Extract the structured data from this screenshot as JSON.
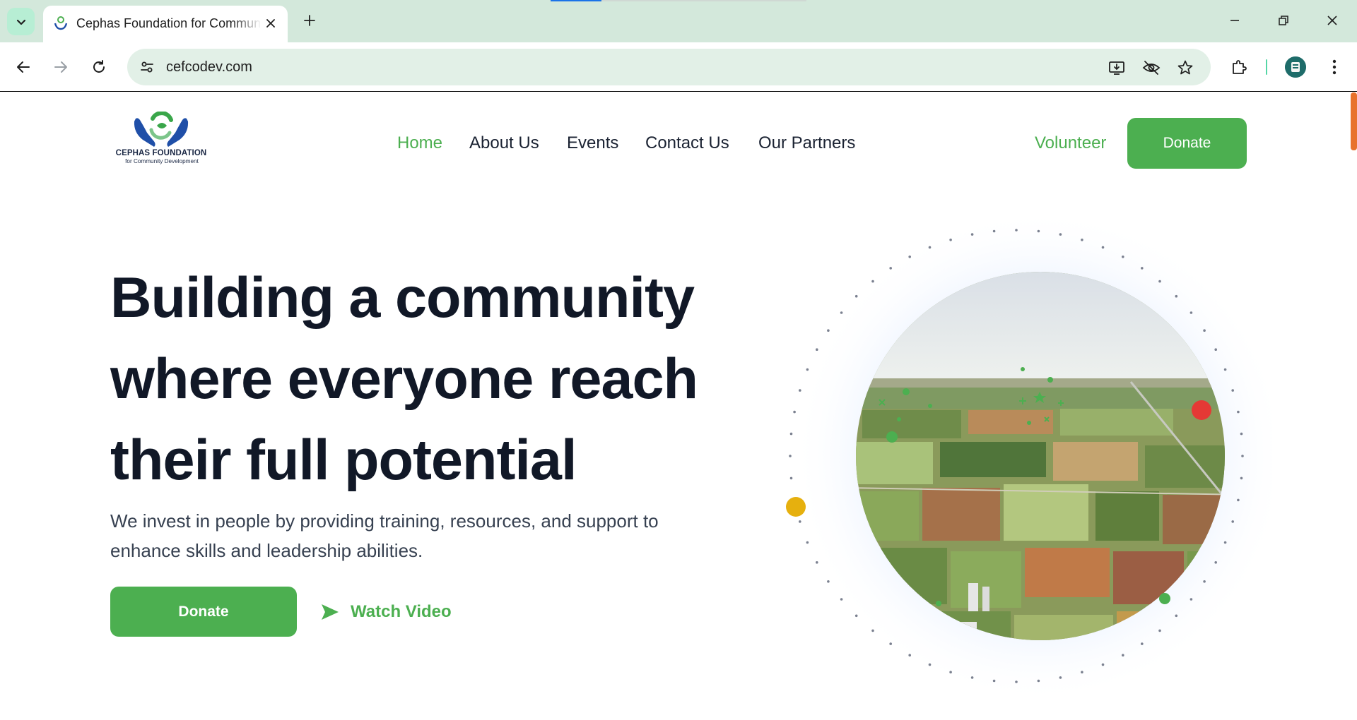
{
  "browser": {
    "tab_title": "Cephas Foundation for Community Development",
    "url": "cefcodev.com",
    "icons": {
      "tab_search": "chevron-down-icon",
      "tab_close": "close-icon",
      "new_tab": "plus-icon",
      "minimize": "minimize-icon",
      "restore": "restore-icon",
      "close_window": "close-icon",
      "back": "back-arrow-icon",
      "forward": "forward-arrow-icon",
      "reload": "reload-icon",
      "site_info": "tune-icon",
      "install": "install-app-icon",
      "tracking": "eye-off-icon",
      "bookmark": "star-icon",
      "extensions": "puzzle-icon",
      "profile": "avatar",
      "menu": "kebab-menu-icon"
    }
  },
  "site": {
    "logo": {
      "name": "CEPHAS FOUNDATION",
      "tagline": "for Community Development"
    },
    "nav": [
      {
        "label": "Home",
        "active": true
      },
      {
        "label": "About Us",
        "active": false
      },
      {
        "label": "Events",
        "active": false
      },
      {
        "label": "Contact Us",
        "active": false
      },
      {
        "label": "Our Partners",
        "active": false
      }
    ],
    "volunteer_label": "Volunteer",
    "donate_label": "Donate"
  },
  "hero": {
    "title_lines": [
      "Building a community",
      "where everyone reach",
      "their full potential"
    ],
    "description_lines": [
      "We invest in people by providing training, resources, and support to",
      "enhance skills and leadership abilities."
    ],
    "donate_label": "Donate",
    "watch_video_label": "Watch Video",
    "visual": "aerial farmland photo in circle",
    "accent_dots": [
      "#e53935",
      "#e6b00e",
      "#4caf50"
    ]
  },
  "colors": {
    "brand_green": "#4caf50",
    "heading": "#111827",
    "chrome_bg": "#d3e8db",
    "omnibox_bg": "#e2f0e7",
    "scrollbar": "#e8722c"
  }
}
